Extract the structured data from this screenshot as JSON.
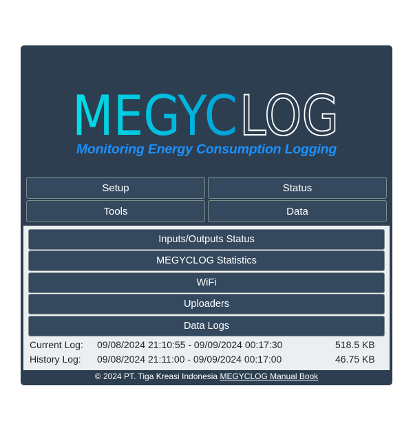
{
  "logo": {
    "part1": "MEGYC",
    "part2": "LOG",
    "tagline": "Monitoring Energy Consumption Logging",
    "colors": {
      "gradient_start": "#00e0e6",
      "gradient_end": "#00a3d9",
      "outline": "#ffffff",
      "tagline": "#1e90ff"
    }
  },
  "nav": {
    "setup": "Setup",
    "status": "Status",
    "tools": "Tools",
    "data": "Data"
  },
  "status_menu": [
    {
      "label": "Inputs/Outputs Status"
    },
    {
      "label": "MEGYCLOG Statistics"
    },
    {
      "label": "WiFi"
    },
    {
      "label": "Uploaders"
    },
    {
      "label": "Data Logs"
    }
  ],
  "logs": {
    "current": {
      "label": "Current Log:",
      "range": "09/08/2024 21:10:55 - 09/09/2024 00:17:30",
      "size": "518.5 KB"
    },
    "history": {
      "label": "History Log:",
      "range": "09/08/2024 21:11:00 - 09/09/2024 00:17:00",
      "size": "46.75 KB"
    }
  },
  "footer": {
    "copyright": "© 2024 PT. Tiga Kreasi Indonesia",
    "manual_link": "MEGYCLOG Manual Book"
  },
  "colors": {
    "panel_bg": "#2c3e50",
    "button_bg": "#34495e",
    "content_bg": "#eceff1"
  }
}
